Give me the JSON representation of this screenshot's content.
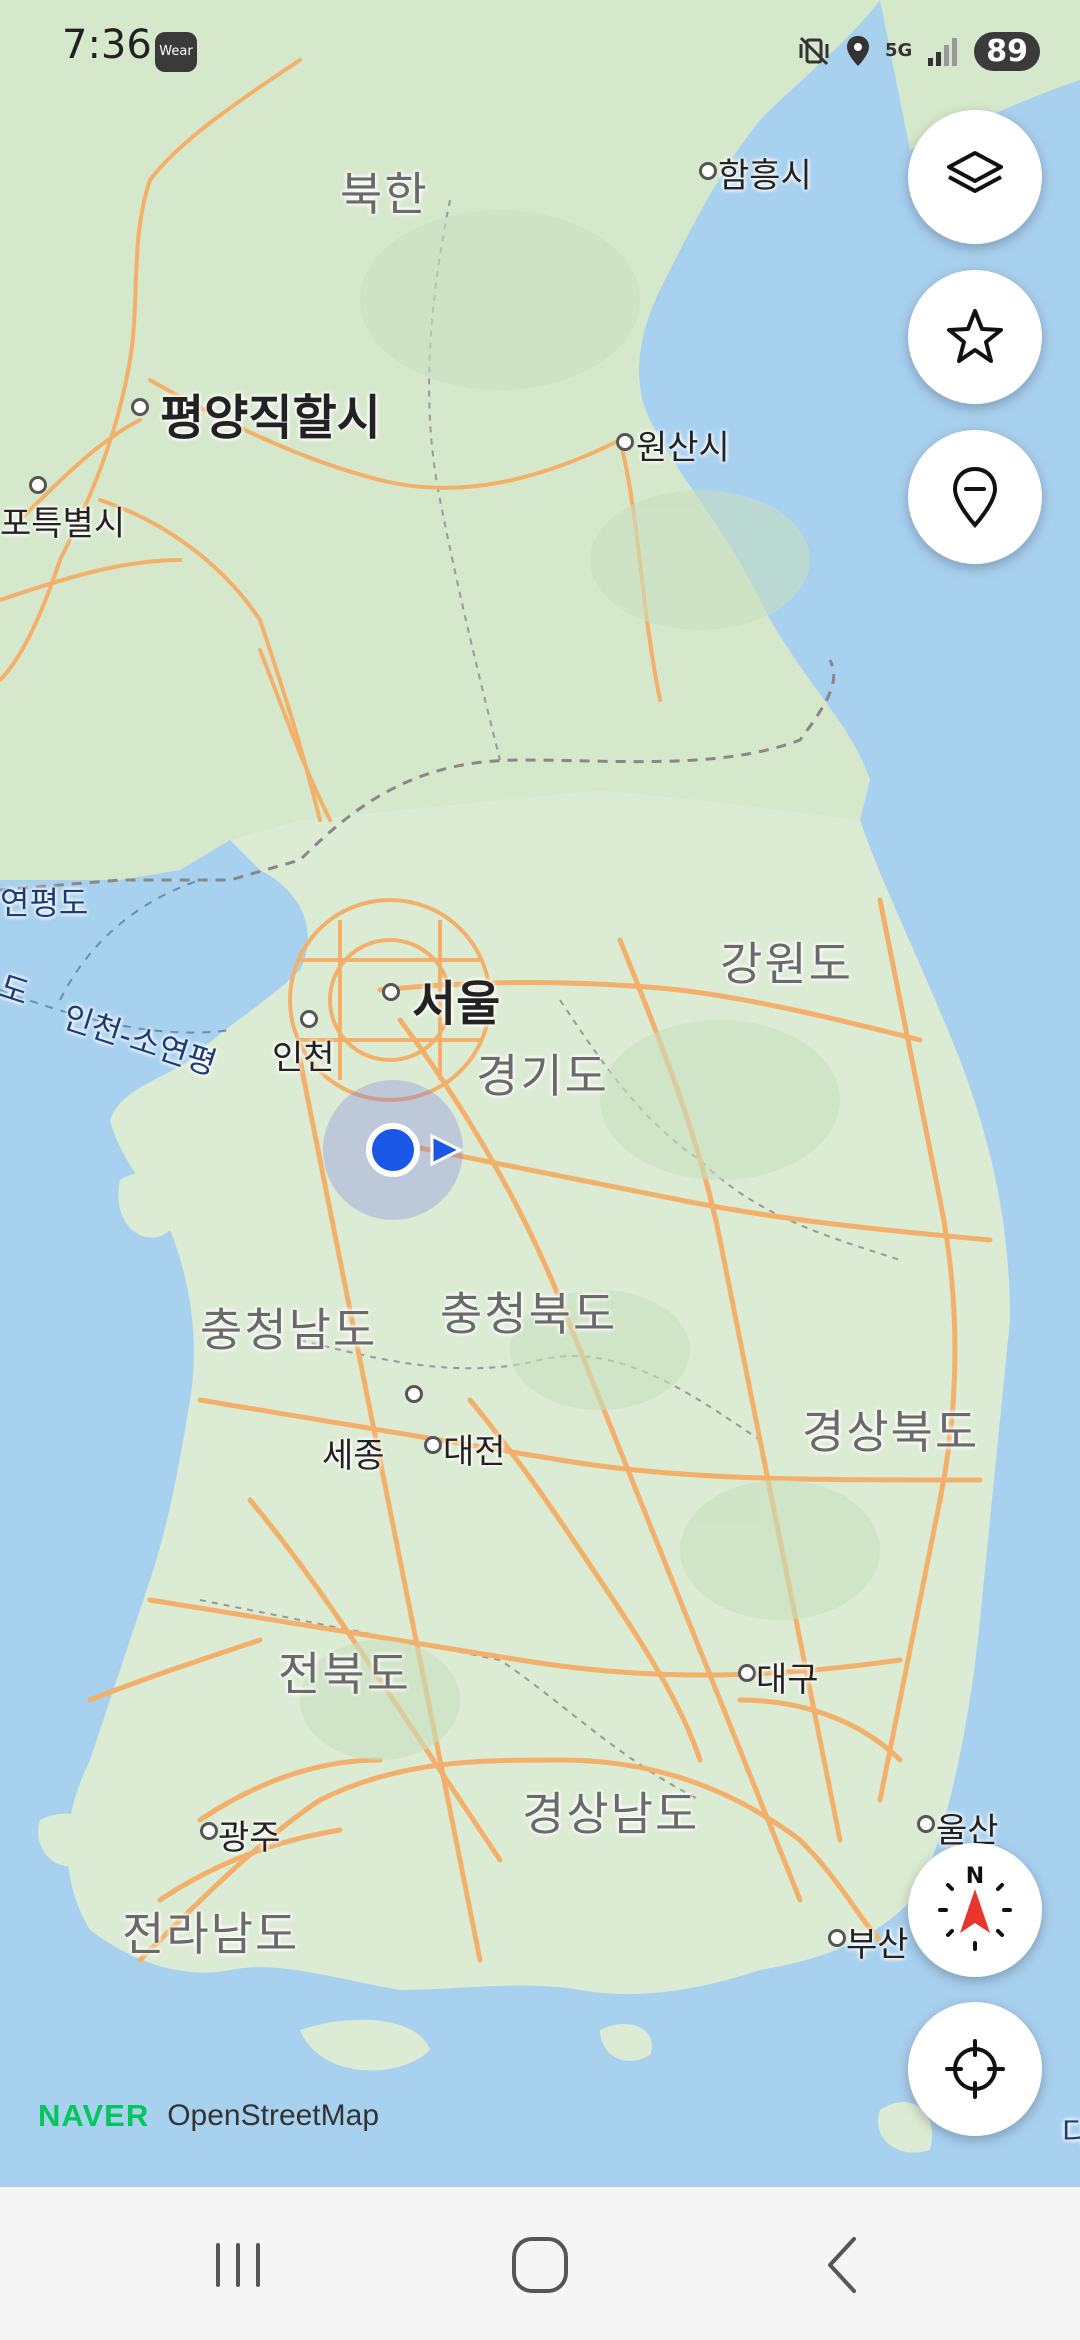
{
  "status_bar": {
    "time": "7:36",
    "wear_label": "Wear",
    "network": "5G",
    "battery": "89",
    "icons": [
      "mute-vibrate-icon",
      "location-icon",
      "5g-icon",
      "signal-icon",
      "battery-icon"
    ]
  },
  "map": {
    "regions": {
      "north_korea": "북한",
      "gangwon": "강원도",
      "gyeonggi": "경기도",
      "chungnam": "충청남도",
      "chungbuk": "충청북도",
      "gyeongbuk": "경상북도",
      "jeonbuk": "전북도",
      "gyeongnam": "경상남도",
      "jeonnam": "전라남도"
    },
    "cities": {
      "hamheung": "함흥시",
      "pyongyang": "평양직할시",
      "wonsan": "원산시",
      "nampo": "포특별시",
      "seoul": "서울",
      "incheon": "인천",
      "sejong": "세종",
      "daejeon": "대전",
      "daegu": "대구",
      "ulsan": "울산",
      "busan": "부산",
      "gwangju": "광주"
    },
    "sea_labels": {
      "yeonpyeong": "연평도",
      "route": "인천-소연평",
      "left_do": "도",
      "right_edge": "다"
    },
    "colors": {
      "sea": "#a8d0ef",
      "land": "#dcebd3",
      "road": "#f2b06a",
      "user_location": "#1a57e6"
    }
  },
  "controls": {
    "layers_icon": "layers-icon",
    "favorites_icon": "star-icon",
    "place_icon": "location-minus-icon",
    "compass_label": "N",
    "my_location_icon": "crosshair-icon"
  },
  "attribution": {
    "brand": "NAVER",
    "source": "OpenStreetMap"
  },
  "nav_bar": {
    "icons": [
      "recent-apps-icon",
      "home-icon",
      "back-icon"
    ]
  }
}
